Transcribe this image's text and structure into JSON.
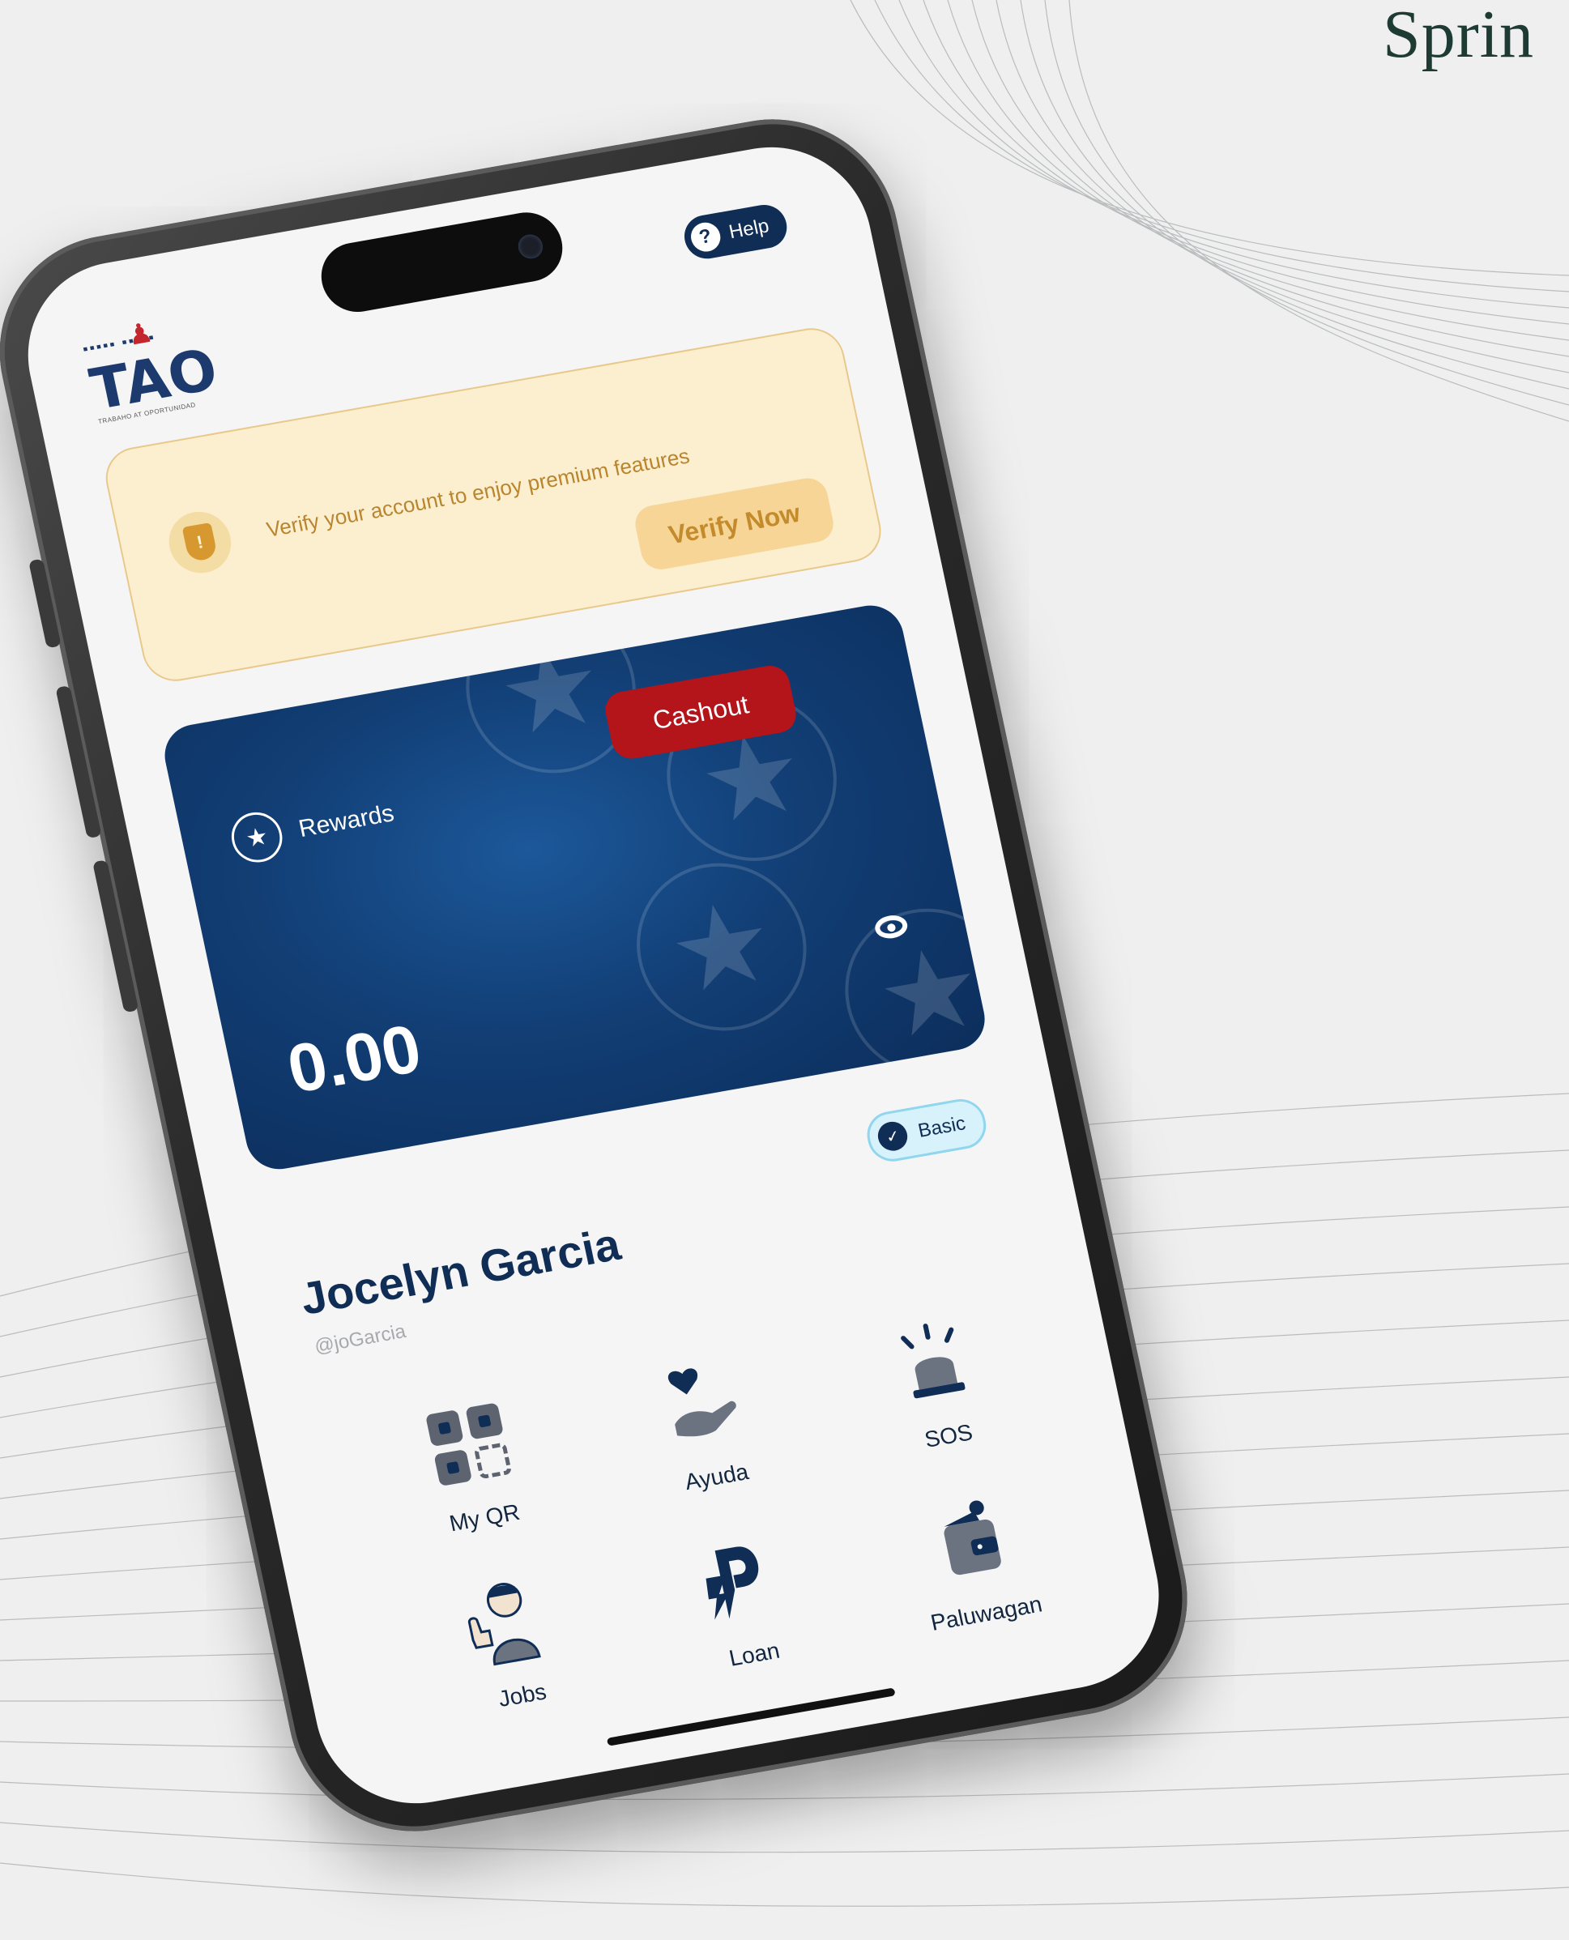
{
  "brand": {
    "partial_text": "Sprin"
  },
  "app": {
    "logo_text": "TAO",
    "logo_subtext": "TRABAHO AT OPORTUNIDAD"
  },
  "header": {
    "help_label": "Help"
  },
  "verify_banner": {
    "message": "Verify your account to enjoy premium features",
    "button_label": "Verify Now"
  },
  "rewards": {
    "label": "Rewards",
    "cashout_label": "Cashout",
    "balance": "0.00"
  },
  "profile": {
    "badge_label": "Basic",
    "name": "Jocelyn Garcia",
    "handle": "@joGarcia"
  },
  "menu": {
    "items": [
      {
        "label": "My QR",
        "icon": "qr-code-icon"
      },
      {
        "label": "Ayuda",
        "icon": "heart-hand-icon"
      },
      {
        "label": "SOS",
        "icon": "siren-icon"
      },
      {
        "label": "Jobs",
        "icon": "worker-thumbs-up-icon"
      },
      {
        "label": "Loan",
        "icon": "loan-logo-icon"
      },
      {
        "label": "Paluwagan",
        "icon": "wallet-icon"
      }
    ]
  },
  "colors": {
    "navy": "#0f2d55",
    "cashout_red": "#b3151b",
    "banner_bg": "#fcefd0",
    "banner_text": "#b9852e",
    "badge_bg": "#d8f2fb"
  }
}
